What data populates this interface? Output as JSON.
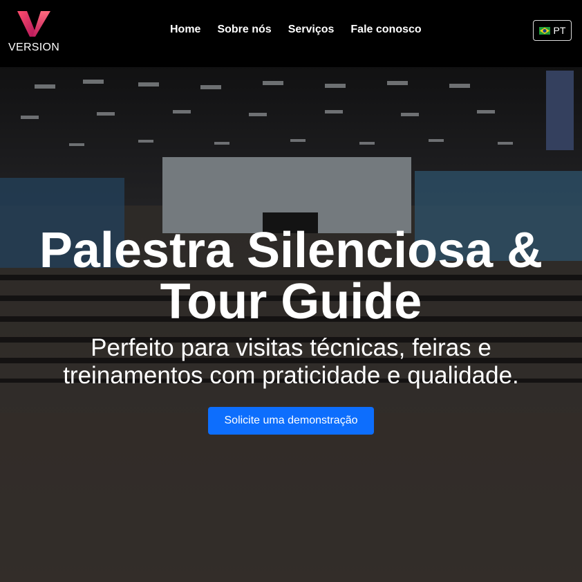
{
  "header": {
    "logo_text": "VERSION",
    "nav": [
      {
        "label": "Home"
      },
      {
        "label": "Sobre nós"
      },
      {
        "label": "Serviços"
      },
      {
        "label": "Fale conosco"
      }
    ],
    "language": {
      "label": "PT",
      "flag_icon": "brazil-flag-icon"
    }
  },
  "hero": {
    "title": "Palestra Silenciosa & Tour Guide",
    "subtitle": "Perfeito para visitas técnicas, feiras e treinamentos com praticidade e qualidade.",
    "cta_label": "Solicite uma demonstração"
  },
  "colors": {
    "cta": "#0d6efd",
    "logo_gradient_start": "#ff4a68",
    "logo_gradient_end": "#b8175a",
    "navbar": "#000000"
  }
}
